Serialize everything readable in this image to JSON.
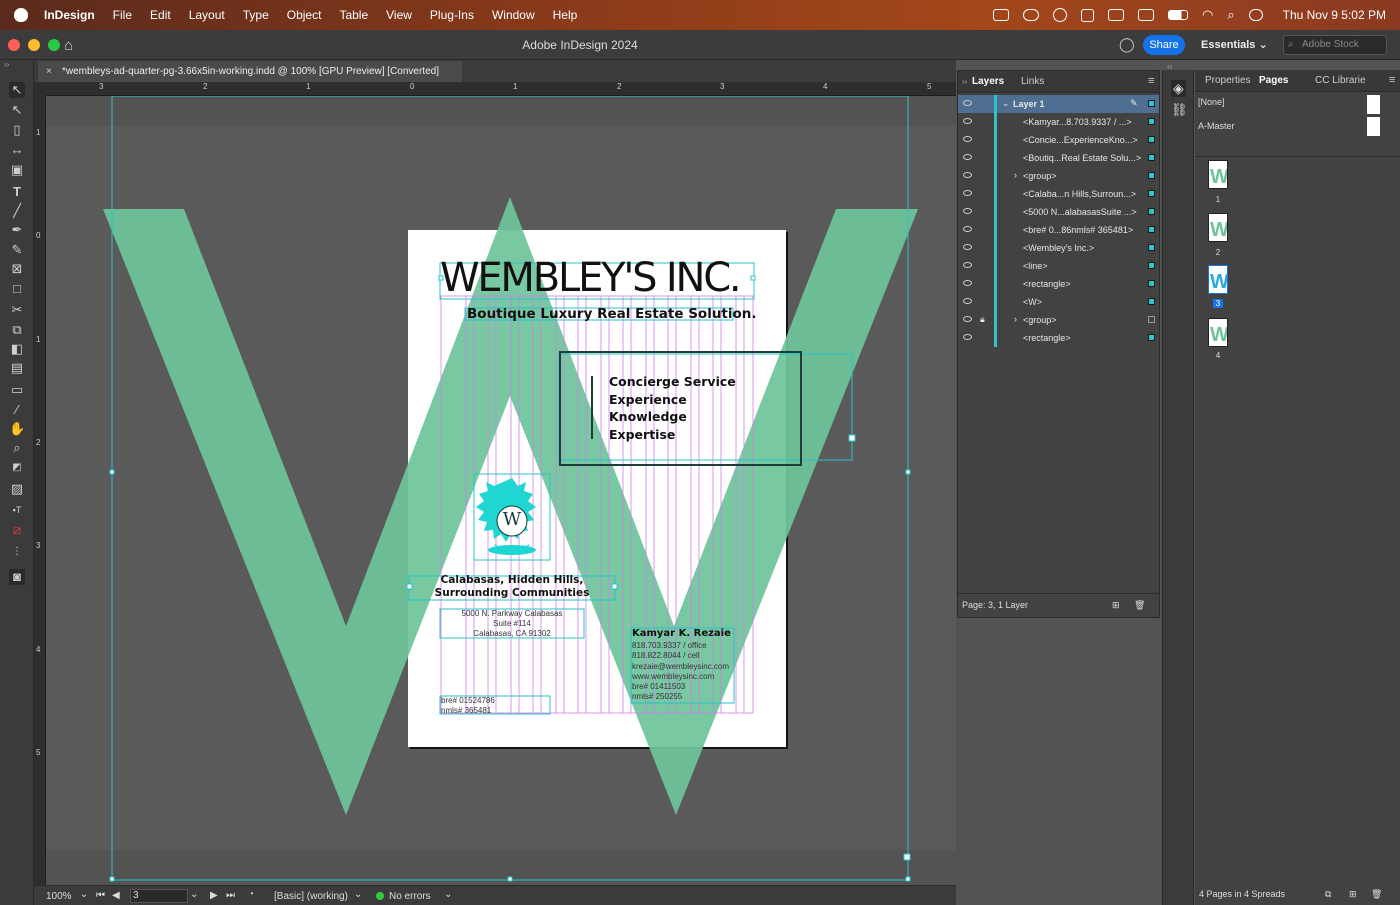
{
  "menubar": {
    "app_name": "InDesign",
    "menus": [
      "File",
      "Edit",
      "Layout",
      "Type",
      "Object",
      "Table",
      "View",
      "Plug-Ins",
      "Window",
      "Help"
    ],
    "clock": "Thu Nov 9  5:02 PM"
  },
  "window": {
    "title": "Adobe InDesign 2024",
    "share_label": "Share",
    "workspace": "Essentials",
    "stock_placeholder": "Adobe Stock"
  },
  "document": {
    "tab_title": "*wembleys-ad-quarter-pg-3.66x5in-working.indd @ 100% [GPU Preview] [Converted]",
    "hruler_labels": [
      "3",
      "2",
      "1",
      "0",
      "1",
      "2",
      "3",
      "4",
      "5"
    ],
    "vruler_labels": [
      "1",
      "0",
      "1",
      "2",
      "3",
      "4",
      "5"
    ]
  },
  "ad": {
    "company": "WEMBLEY'S INC.",
    "tagline": "Boutique Luxury Real Estate Solution.",
    "services": [
      "Concierge Service",
      "Experience",
      "Knowledge",
      "Expertise"
    ],
    "emblem_letter": "W",
    "region": "Calabasas, Hidden Hills,\nSurrounding Communities",
    "address": [
      "5000 N. Parkway Calabasas",
      "Suite #114",
      "Calabasas, CA 91302"
    ],
    "licenses": [
      "bre# 01524786",
      "nmls# 365481"
    ],
    "agent_name": "Kamyar K. Rezaie",
    "agent_lines": [
      "818.703.9337 / office",
      "818.822.8044 / cell",
      "krezaie@wembleysinc.com",
      "www.wembleysinc.com",
      "bre# 01411503",
      "nmls# 250255"
    ],
    "colors": {
      "w_green": "#6ec49a",
      "emblem": "#1fd6d2",
      "frame_cyan": "#25c4c9",
      "column_magenta": "#d57bf0"
    }
  },
  "status": {
    "zoom": "100%",
    "page": "3",
    "style": "[Basic] (working)",
    "preflight": "No errors"
  },
  "layers": {
    "tabs": [
      "Layers",
      "Links"
    ],
    "layer_name": "Layer 1",
    "items": [
      "<Kamyar...8.703.9337 / ...>",
      "<Concie...ExperienceKno...>",
      "<Boutiq...Real Estate Solu...>",
      "<group>",
      "<Calaba...n Hills,Surroun...>",
      "<5000 N...alabasasSuite ...>",
      "<bre# 0...86nmls# 365481>",
      "<Wembley's Inc.>",
      "<line>",
      "<rectangle>",
      "<W>",
      "<group>",
      "<rectangle>"
    ],
    "footer": "Page: 3, 1 Layer"
  },
  "pages": {
    "tabs": [
      "Properties",
      "Pages",
      "CC Librarie"
    ],
    "masters": [
      "[None]",
      "A-Master"
    ],
    "page_numbers": [
      "1",
      "2",
      "3",
      "4"
    ],
    "footer": "4 Pages in 4 Spreads"
  }
}
